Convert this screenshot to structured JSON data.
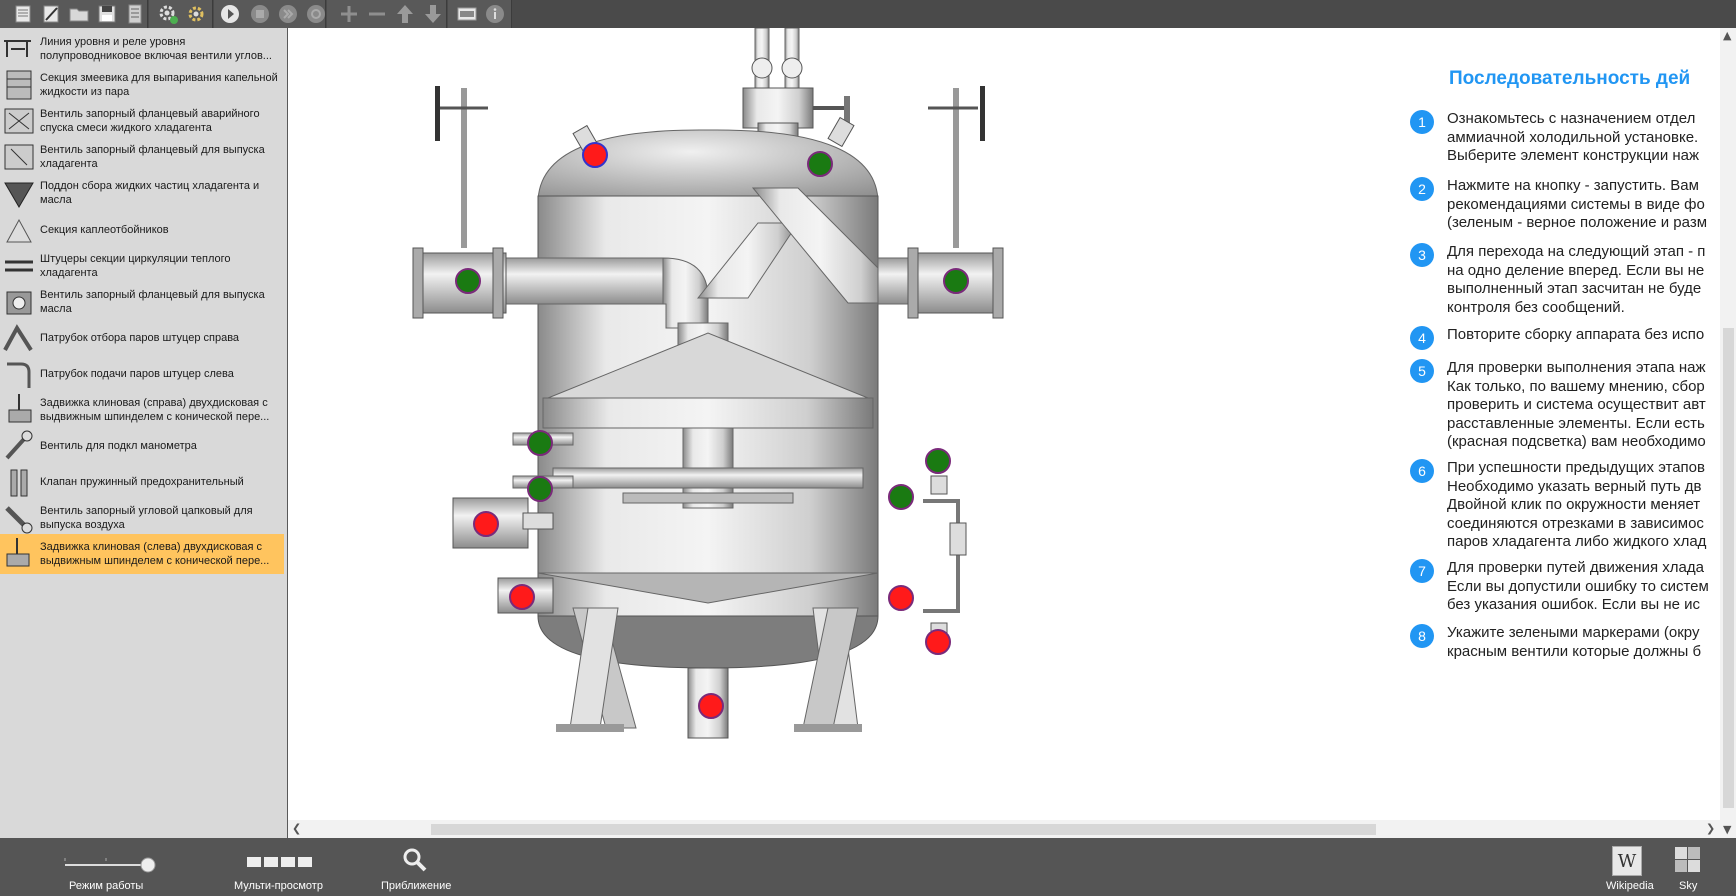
{
  "toolbar": {
    "buttons": [
      "new-document-icon",
      "edit-icon",
      "open-folder-icon",
      "save-icon",
      "save-list-icon",
      "settings-icon",
      "settings-gear-icon",
      "play-icon",
      "stop-icon",
      "step-icon",
      "refresh-icon",
      "add-icon",
      "remove-icon",
      "up-icon",
      "down-icon",
      "screen-icon",
      "info-icon"
    ]
  },
  "palette": {
    "items": [
      {
        "line1": "Линия уровня и реле уровня",
        "line2": "полупроводниковое включая вентили углов..."
      },
      {
        "line1": "Секция змеевика для выпаривания капельной",
        "line2": "жидкости из пара"
      },
      {
        "line1": "Вентиль запорный фланцевый аварийного",
        "line2": "спуска смеси жидкого хладагента"
      },
      {
        "line1": "Вентиль запорный фланцевый для выпуска",
        "line2": "хладагента"
      },
      {
        "line1": "Поддон сбора жидких частиц хладагента и",
        "line2": "масла"
      },
      {
        "line1": "Секция каплеотбойников",
        "line2": ""
      },
      {
        "line1": "Штуцеры секции циркуляции теплого",
        "line2": "хладагента"
      },
      {
        "line1": "Вентиль запорный фланцевый для выпуска",
        "line2": "масла"
      },
      {
        "line1": "Патрубок отбора паров штуцер справа",
        "line2": ""
      },
      {
        "line1": "Патрубок подачи паров штуцер слева",
        "line2": ""
      },
      {
        "line1": "Задвижка клиновая (справа)  двухдисковая с",
        "line2": "выдвижным   шпинделем с конической пере..."
      },
      {
        "line1": "Вентиль для подкл манометра",
        "line2": ""
      },
      {
        "line1": "Клапан пружинный предохранительный",
        "line2": ""
      },
      {
        "line1": "Вентиль запорный  угловой цапковый  для",
        "line2": "выпуска воздуха"
      },
      {
        "line1": "Задвижка клиновая (слева) двухдисковая с",
        "line2": "выдвижным   шпинделем с конической пере..."
      }
    ],
    "selected_index": 14
  },
  "instructions": {
    "title": "Последовательность дей",
    "steps": [
      {
        "num": "1",
        "lines": [
          "Ознакомьтесь с назначением  отдел",
          "аммиачной холодильной установке.",
          "Выберите элемент конструкции наж"
        ]
      },
      {
        "num": "2",
        "lines": [
          "Нажмите на кнопку - запустить. Вам",
          "рекомендациями системы в виде фо",
          "(зеленым - верное положение и разм"
        ]
      },
      {
        "num": "3",
        "lines": [
          "Для перехода на следующий этап - п",
          "на одно деление вперед. Если вы не",
          "выполненный этап засчитан не буде",
          "контроля без сообщений."
        ]
      },
      {
        "num": "4",
        "lines": [
          "Повторите сборку аппарата без испо"
        ]
      },
      {
        "num": "5",
        "lines": [
          "Для проверки выполнения этапа наж",
          "Как только, по вашему мнению, сбор",
          "проверить и система осуществит авт",
          "расставленные элементы. Если есть",
          "(красная подсветка) вам необходимо"
        ]
      },
      {
        "num": "6",
        "lines": [
          "При успешности предыдущих этапов",
          "Необходимо указать верный путь дв",
          "Двойной клик по окружности меняет",
          "соединяются отрезками в зависимос",
          "паров хладагента либо жидкого хлад"
        ]
      },
      {
        "num": "7",
        "lines": [
          "Для проверки путей движения хлада",
          "Если вы допустили ошибку то систем",
          "без указания ошибок. Если вы не ис"
        ]
      },
      {
        "num": "8",
        "lines": [
          "Укажите зелеными маркерами (окру",
          "красным вентили которые должны б"
        ]
      }
    ]
  },
  "markers": {
    "colors": {
      "green": "#1a7a12",
      "red": "#ff1a1a",
      "green_border": "#7a2a7a",
      "red_border": "#3333cc"
    }
  },
  "bottombar": {
    "mode_label": "Режим работы",
    "multiview_label": "Мульти-просмотр",
    "zoom_label": "Приближение",
    "wikipedia_label": "Wikipedia",
    "sky_label": "Sky",
    "mode_slider_value": 1.0
  }
}
